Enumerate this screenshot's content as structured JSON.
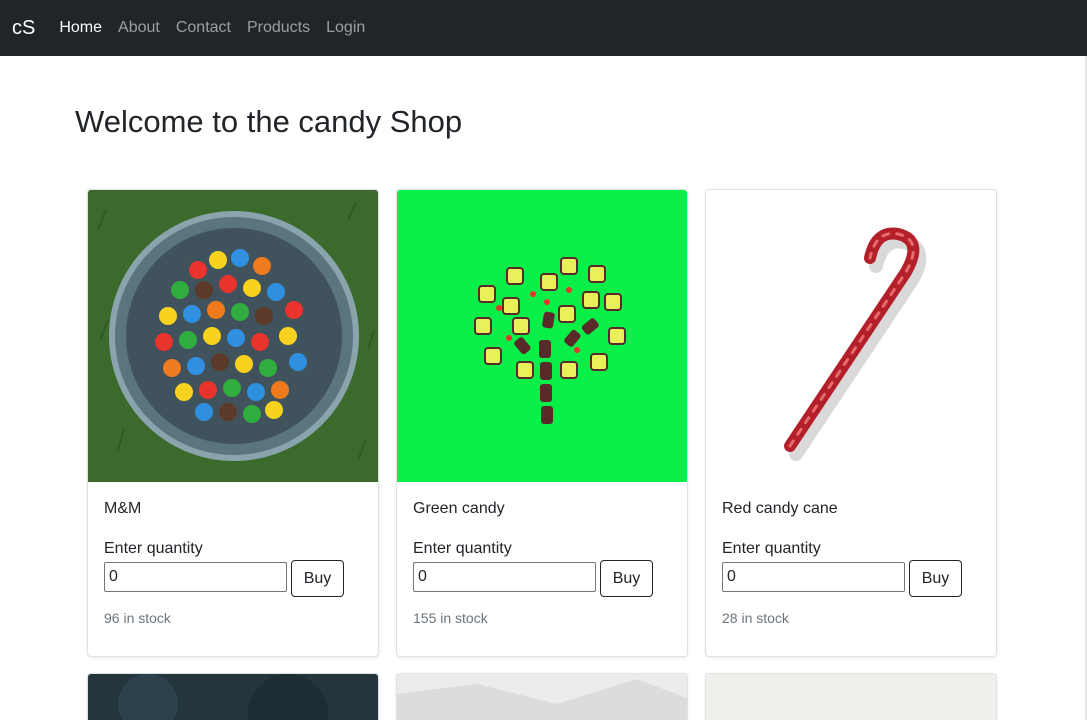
{
  "nav": {
    "brand": "cS",
    "links": [
      "Home",
      "About",
      "Contact",
      "Products",
      "Login"
    ],
    "active": "Home"
  },
  "page": {
    "title": "Welcome to the candy Shop"
  },
  "products": [
    {
      "name": "M&M",
      "quantity_label": "Enter quantity",
      "quantity_value": "0",
      "buy_label": "Buy",
      "stock": "96 in stock",
      "image": "colorful-candies-bowl-on-grass"
    },
    {
      "name": "Green candy",
      "quantity_label": "Enter quantity",
      "quantity_value": "0",
      "buy_label": "Buy",
      "stock": "155 in stock",
      "image": "candy-tree-on-green"
    },
    {
      "name": "Red candy cane",
      "quantity_label": "Enter quantity",
      "quantity_value": "0",
      "buy_label": "Buy",
      "stock": "28 in stock",
      "image": "red-candy-cane-on-white"
    }
  ],
  "colors": {
    "navbar_bg": "#212529",
    "text": "#212529",
    "muted": "#6c757d",
    "bright_green": "#08f048"
  }
}
